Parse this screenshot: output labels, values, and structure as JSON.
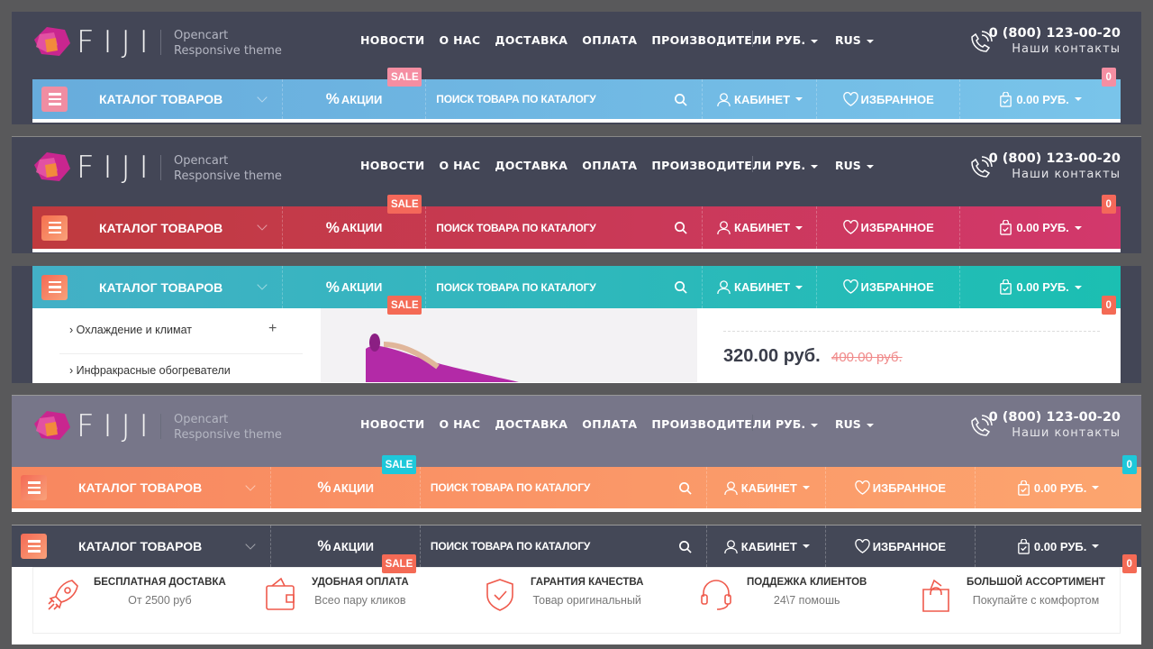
{
  "header": {
    "logo_text": "FIJI",
    "tagline_1": "Opencart",
    "tagline_2": "Responsive theme",
    "nav": [
      "НОВОСТИ",
      "О НАС",
      "ДОСТАВКА",
      "ОПЛАТА",
      "ПРОИЗВОДИТЕЛИ"
    ],
    "currency": "РУБ.",
    "language": "RUS",
    "phone": "0 (800) 123-00-20",
    "contacts": "Наши контакты"
  },
  "bar": {
    "catalog": "КАТАЛОГ ТОВАРОВ",
    "promo_symbol": "%",
    "promo": "АКЦИИ",
    "search_placeholder": "ПОИСК ТОВАРА ПО КАТАЛОГУ",
    "account": "КАБИНЕТ",
    "wishlist": "ИЗБРАННОЕ",
    "cart_total": "0.00 РУБ.",
    "cart_count": "0",
    "sale_badge": "SALE"
  },
  "variants": [
    {
      "name": "blue",
      "bar_from": "#67acdc",
      "bar_to": "#79c4ea",
      "badge": "#f58ea2",
      "menu": "#f08da2"
    },
    {
      "name": "red",
      "bar_from": "#bf3a3e",
      "bar_to": "#d2386c",
      "badge": "#f4685a",
      "menu": "#f5704e"
    },
    {
      "name": "teal",
      "bar_from": "#43b0c6",
      "bar_to": "#1bbfb2",
      "badge": "#f46a55",
      "menu": "#f46a55"
    },
    {
      "name": "orange",
      "bar_from": "#f8875f",
      "bar_to": "#fca56f",
      "badge": "#1ec8da",
      "menu": "#f46a55"
    },
    {
      "name": "dark",
      "bar_from": "#444857",
      "bar_to": "#444857",
      "badge": "#f46a55",
      "menu": "#f46a55"
    }
  ],
  "product_preview": {
    "categories": [
      "Охлаждение и климат",
      "Инфракрасные обогреватели"
    ],
    "price": "320.00 руб.",
    "old_price": "400.00 руб."
  },
  "features": [
    {
      "icon": "rocket-icon",
      "title": "БЕСПЛАТНАЯ ДОСТАВКА",
      "subtitle": "От 2500 руб"
    },
    {
      "icon": "wallet-icon",
      "title": "УДОБНАЯ ОПЛАТА",
      "subtitle": "Всео пару кликов"
    },
    {
      "icon": "shield-check-icon",
      "title": "ГАРАНТИЯ КАЧЕСТВА",
      "subtitle": "Товар оригинальный"
    },
    {
      "icon": "headset-icon",
      "title": "ПОДДЕЖКА КЛИЕНТОВ",
      "subtitle": "24\\7 помошь"
    },
    {
      "icon": "shopping-bag-icon",
      "title": "БОЛЬШОЙ АССОРТИМЕНТ",
      "subtitle": "Покупайте с комфортом"
    }
  ]
}
